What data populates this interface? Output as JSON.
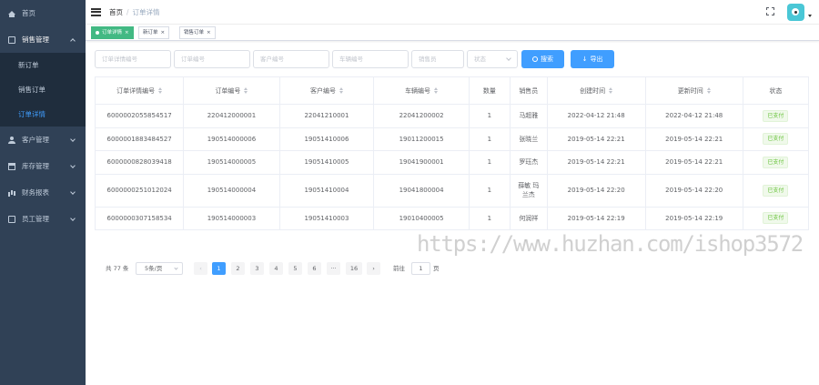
{
  "sidebar": {
    "items": [
      {
        "label": "首页",
        "icon": "home-icon"
      },
      {
        "label": "销售管理",
        "icon": "box-icon"
      },
      {
        "label": "新订单"
      },
      {
        "label": "销售订单"
      },
      {
        "label": "订单详情"
      },
      {
        "label": "客户管理",
        "icon": "user-icon"
      },
      {
        "label": "库存管理",
        "icon": "store-icon"
      },
      {
        "label": "财务报表",
        "icon": "chart-icon"
      },
      {
        "label": "员工管理",
        "icon": "badge-icon"
      }
    ]
  },
  "header": {
    "breadcrumb_home": "首页",
    "breadcrumb_sep": "/",
    "breadcrumb_current": "订单详情"
  },
  "tags": [
    {
      "label": "订单详情",
      "close": "×"
    },
    {
      "label": "新订单",
      "close": "×"
    },
    {
      "label": "销售订单",
      "close": "×"
    }
  ],
  "filters": {
    "detail_id": "订单详情编号",
    "order_id": "订单编号",
    "customer_id": "客户编号",
    "vehicle_id": "车辆编号",
    "seller": "销售员",
    "status": "状态",
    "search_button": "搜索",
    "export_button": "导出"
  },
  "table": {
    "headers": [
      "订单详情编号",
      "订单编号",
      "客户编号",
      "车辆编号",
      "数量",
      "销售员",
      "创建时间",
      "更新时间",
      "状态"
    ],
    "rows": [
      {
        "detail_id": "6000002055854517",
        "order_id": "220412000001",
        "customer_id": "22041210001",
        "vehicle_id": "22041200002",
        "qty": "1",
        "seller": "马超雅",
        "created": "2022-04-12 21:48",
        "updated": "2022-04-12 21:48",
        "status": "已支付"
      },
      {
        "detail_id": "6000001883484527",
        "order_id": "190514000006",
        "customer_id": "19051410006",
        "vehicle_id": "19011200015",
        "qty": "1",
        "seller": "张晓兰",
        "created": "2019-05-14 22:21",
        "updated": "2019-05-14 22:21",
        "status": "已支付"
      },
      {
        "detail_id": "6000000828039418",
        "order_id": "190514000005",
        "customer_id": "19051410005",
        "vehicle_id": "19041900001",
        "qty": "1",
        "seller": "罗珏杰",
        "created": "2019-05-14 22:21",
        "updated": "2019-05-14 22:21",
        "status": "已支付"
      },
      {
        "detail_id": "6000000251012024",
        "order_id": "190514000004",
        "customer_id": "19051410004",
        "vehicle_id": "19041800004",
        "qty": "1",
        "seller": "薛敏 玛兰杰",
        "created": "2019-05-14 22:20",
        "updated": "2019-05-14 22:20",
        "status": "已支付"
      },
      {
        "detail_id": "6000000307158534",
        "order_id": "190514000003",
        "customer_id": "19051410003",
        "vehicle_id": "19010400005",
        "qty": "1",
        "seller": "何润祥",
        "created": "2019-05-14 22:19",
        "updated": "2019-05-14 22:19",
        "status": "已支付"
      }
    ]
  },
  "pagination": {
    "total": "共 77 条",
    "page_size": "5条/页",
    "prev": "‹",
    "next": "›",
    "pages": [
      "1",
      "2",
      "3",
      "4",
      "5",
      "6",
      "···",
      "16"
    ],
    "jump_label": "前往",
    "jump_value": "1",
    "jump_suffix": "页"
  },
  "watermark": "https://www.huzhan.com/ishop3572",
  "colors": {
    "sidebar_bg": "#304156",
    "accent": "#409eff",
    "tag_active": "#42b983",
    "status_green": "#67c23a"
  }
}
